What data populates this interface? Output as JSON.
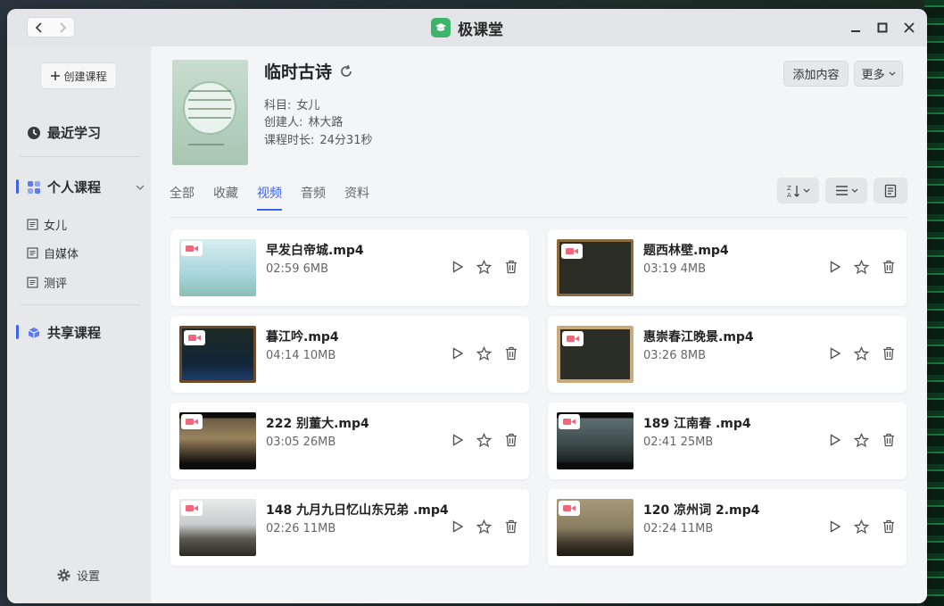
{
  "app": {
    "title": "极课堂",
    "accent": "#3b63f0",
    "logo_color": "#3cb46a"
  },
  "titlebar": {
    "back_icon": "chevron-left-icon",
    "forward_icon": "chevron-right-icon"
  },
  "sidebar": {
    "create_label": "创建课程",
    "recent_label": "最近学习",
    "personal_label": "个人课程",
    "personal_items": [
      {
        "label": "女儿"
      },
      {
        "label": "自媒体"
      },
      {
        "label": "测评"
      }
    ],
    "shared_label": "共享课程",
    "settings_label": "设置"
  },
  "course": {
    "title": "临时古诗",
    "subject_key": "科目:",
    "subject_val": "女儿",
    "creator_key": "创建人:",
    "creator_val": "林大路",
    "duration_key": "课程时长:",
    "duration_val": "24分31秒",
    "add_label": "添加内容",
    "more_label": "更多"
  },
  "tabs": [
    {
      "label": "全部"
    },
    {
      "label": "收藏"
    },
    {
      "label": "视频"
    },
    {
      "label": "音频"
    },
    {
      "label": "资料"
    }
  ],
  "active_tab": "视频",
  "videos": [
    {
      "name": "早发白帝城.mp4",
      "meta": "02:59 6MB"
    },
    {
      "name": "题西林壁.mp4",
      "meta": "03:19 4MB"
    },
    {
      "name": "暮江吟.mp4",
      "meta": "04:14 10MB"
    },
    {
      "name": "惠崇春江晚景.mp4",
      "meta": "03:26 8MB"
    },
    {
      "name": "222 别董大.mp4",
      "meta": "03:05 26MB"
    },
    {
      "name": "189 江南春 .mp4",
      "meta": "02:41 25MB"
    },
    {
      "name": "148 九月九日忆山东兄弟 .mp4",
      "meta": "02:26 11MB"
    },
    {
      "name": "120 凉州词 2.mp4",
      "meta": "02:24 11MB"
    }
  ]
}
